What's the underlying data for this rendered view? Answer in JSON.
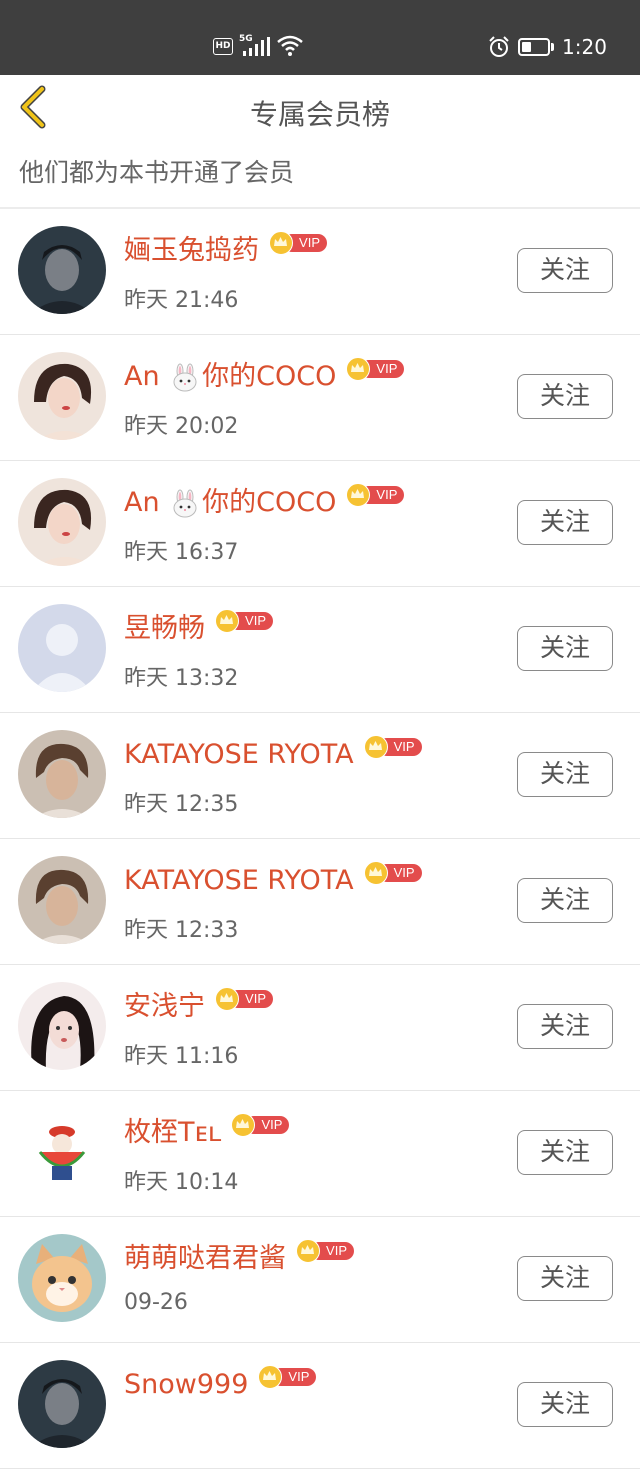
{
  "status_bar": {
    "hd": "HD",
    "net": "5G",
    "time": "1:20",
    "battery_level": 0.35
  },
  "header": {
    "title": "专属会员榜",
    "subtitle": "他们都为本书开通了会员"
  },
  "members": [
    {
      "name_pre": "婳玉兔捣药",
      "emoji": false,
      "name_post": "",
      "time": "昨天 21:46",
      "avatar": "dark-portrait",
      "vip": "VIP",
      "follow": "关注"
    },
    {
      "name_pre": "An ",
      "emoji": true,
      "name_post": "你的COCO",
      "time": "昨天 20:02",
      "avatar": "girl-portrait",
      "vip": "VIP",
      "follow": "关注"
    },
    {
      "name_pre": "An ",
      "emoji": true,
      "name_post": "你的COCO",
      "time": "昨天 16:37",
      "avatar": "girl-portrait",
      "vip": "VIP",
      "follow": "关注"
    },
    {
      "name_pre": "昱畅畅",
      "emoji": false,
      "name_post": "",
      "time": "昨天 13:32",
      "avatar": "default-silhouette",
      "vip": "VIP",
      "follow": "关注"
    },
    {
      "name_pre": "KATAYOSE RYOTA",
      "emoji": false,
      "name_post": "",
      "time": "昨天 12:35",
      "avatar": "boy-portrait",
      "vip": "VIP",
      "follow": "关注"
    },
    {
      "name_pre": "KATAYOSE RYOTA",
      "emoji": false,
      "name_post": "",
      "time": "昨天 12:33",
      "avatar": "boy-portrait",
      "vip": "VIP",
      "follow": "关注"
    },
    {
      "name_pre": "安浅宁",
      "emoji": false,
      "name_post": "",
      "time": "昨天 11:16",
      "avatar": "illustrated-girl",
      "vip": "VIP",
      "follow": "关注"
    },
    {
      "name_pre": "枚桎Tᴇʟ",
      "emoji": false,
      "name_post": "",
      "time": "昨天 10:14",
      "avatar": "watermelon-character",
      "vip": "VIP",
      "follow": "关注"
    },
    {
      "name_pre": "萌萌哒君君酱",
      "emoji": false,
      "name_post": "",
      "time": "09-26",
      "avatar": "cat-photo",
      "vip": "VIP",
      "follow": "关注"
    },
    {
      "name_pre": "Snow999",
      "emoji": false,
      "name_post": "",
      "time": "",
      "avatar": "dark-portrait",
      "vip": "VIP",
      "follow": "关注"
    }
  ],
  "colors": {
    "name": "#d9502f",
    "vip_tag": "#e34c4c",
    "crown": "#f6c232",
    "back_arrow": "#f0c419"
  }
}
